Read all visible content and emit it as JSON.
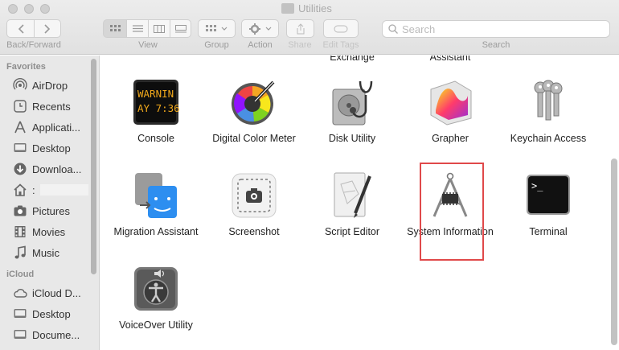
{
  "window": {
    "title": "Utilities"
  },
  "toolbar": {
    "back_forward_label": "Back/Forward",
    "view_label": "View",
    "group_label": "Group",
    "action_label": "Action",
    "share_label": "Share",
    "edit_tags_label": "Edit Tags",
    "search_label": "Search",
    "search_placeholder": "Search"
  },
  "sidebar": {
    "favorites_header": "Favorites",
    "favorites": [
      {
        "label": "AirDrop",
        "icon": "airdrop-icon"
      },
      {
        "label": "Recents",
        "icon": "clock-icon"
      },
      {
        "label": "Applicati...",
        "icon": "applications-icon"
      },
      {
        "label": "Desktop",
        "icon": "desktop-icon"
      },
      {
        "label": "Downloa...",
        "icon": "download-icon"
      },
      {
        "label": ":",
        "icon": "home-icon"
      },
      {
        "label": "Pictures",
        "icon": "camera-icon"
      },
      {
        "label": "Movies",
        "icon": "film-icon"
      },
      {
        "label": "Music",
        "icon": "music-note-icon"
      }
    ],
    "icloud_header": "iCloud",
    "icloud": [
      {
        "label": "iCloud D...",
        "icon": "cloud-icon"
      },
      {
        "label": "Desktop",
        "icon": "desktop-icon"
      },
      {
        "label": "Docume...",
        "icon": "document-icon"
      }
    ]
  },
  "content": {
    "cut_labels": [
      "Exchange",
      "Assistant"
    ],
    "apps": [
      {
        "name": "Console",
        "icon": "console-icon",
        "console_text": [
          "WARNIN",
          "AY 7:36"
        ]
      },
      {
        "name": "Digital Color Meter",
        "icon": "color-meter-icon"
      },
      {
        "name": "Disk Utility",
        "icon": "disk-utility-icon"
      },
      {
        "name": "Grapher",
        "icon": "grapher-icon"
      },
      {
        "name": "Keychain Access",
        "icon": "keys-icon"
      },
      {
        "name": "Migration Assistant",
        "icon": "migration-icon"
      },
      {
        "name": "Screenshot",
        "icon": "screenshot-icon"
      },
      {
        "name": "Script Editor",
        "icon": "script-editor-icon"
      },
      {
        "name": "System Information",
        "icon": "system-information-icon",
        "selected": true
      },
      {
        "name": "Terminal",
        "icon": "terminal-icon",
        "terminal_prompt": ">_"
      },
      {
        "name": "VoiceOver Utility",
        "icon": "voiceover-icon"
      }
    ]
  },
  "colors": {
    "highlight": "#e0494a",
    "sidebar_bg": "#e8e8e8",
    "toolbar_bg": "#e6e6e6"
  }
}
